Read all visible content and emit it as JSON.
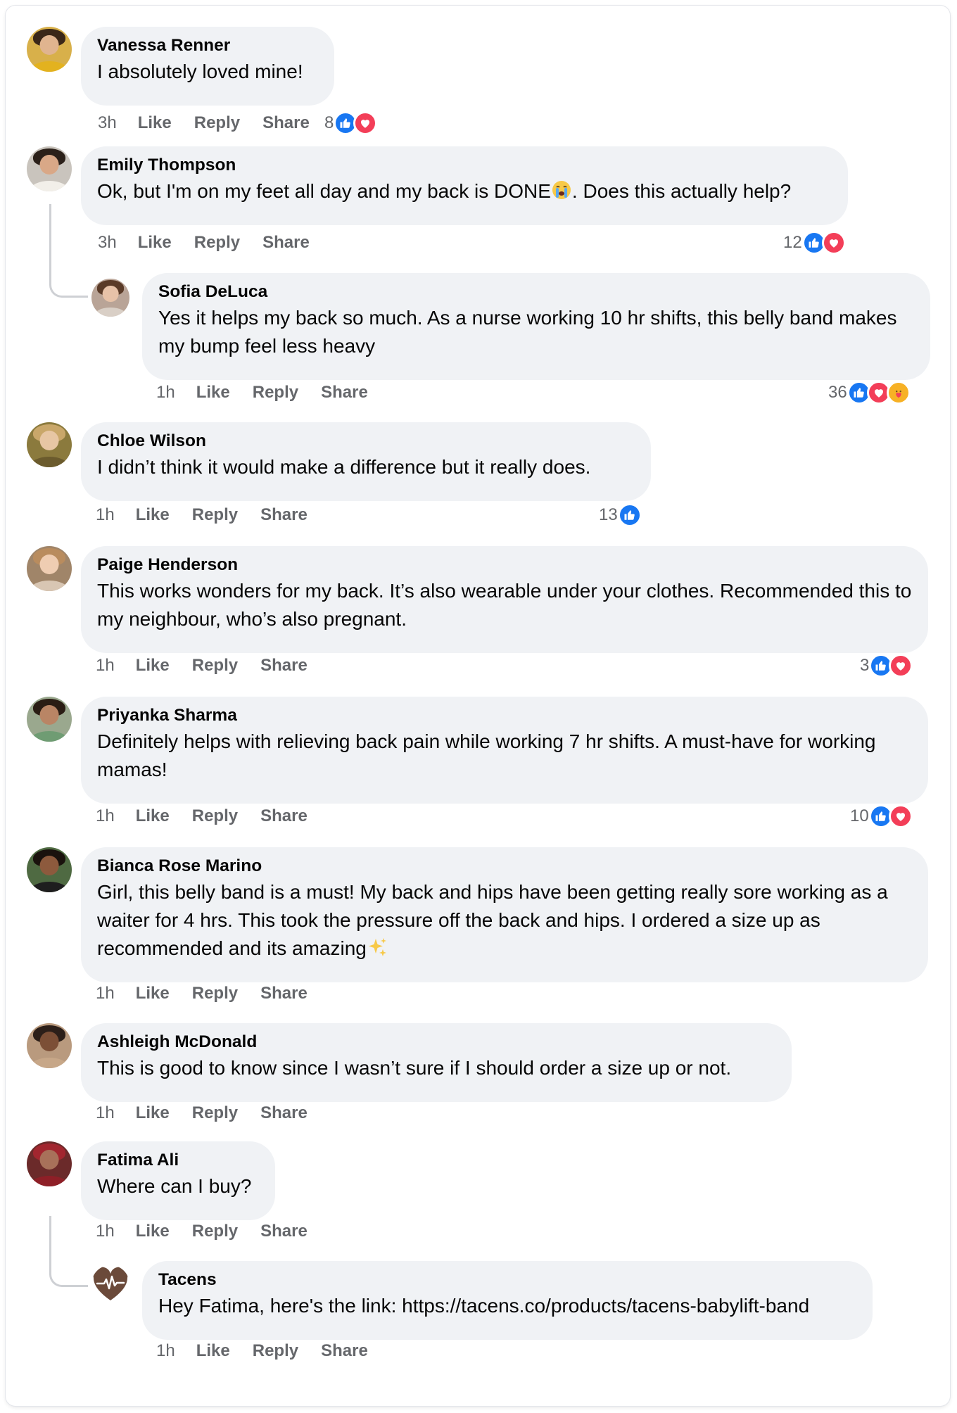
{
  "comments": [
    {
      "name": "Vanessa Renner",
      "text": "I absolutely loved mine!",
      "time": "3h",
      "like": "Like",
      "reply": "Reply",
      "share": "Share",
      "reaction_count": "8",
      "reactions": [
        "like",
        "love"
      ],
      "avatar_colors": {
        "bg": "#d8b04a",
        "hair": "#3a2718",
        "face": "#e0b48f",
        "body": "#e3b21f"
      }
    },
    {
      "name": "Emily Thompson",
      "text_before": "Ok, but I'm on my feet all day and my back is DONE",
      "emoji": "crying-face-emoji",
      "text_after": ". Does this actually help?",
      "time": "3h",
      "like": "Like",
      "reply": "Reply",
      "share": "Share",
      "reaction_count": "12",
      "reactions": [
        "like",
        "love"
      ],
      "avatar_colors": {
        "bg": "#c9c4bd",
        "hair": "#2b2019",
        "face": "#d9a887",
        "body": "#f2efe9"
      }
    },
    {
      "name": "Sofia DeLuca",
      "text": "Yes it helps my back so much. As a nurse working 10 hr shifts, this belly band makes my bump feel less heavy",
      "time": "1h",
      "like": "Like",
      "reply": "Reply",
      "share": "Share",
      "reaction_count": "36",
      "reactions": [
        "like",
        "love",
        "care"
      ],
      "avatar_colors": {
        "bg": "#b9a497",
        "hair": "#5a3b28",
        "face": "#e7c2a8",
        "body": "#d9cfc6"
      }
    },
    {
      "name": "Chloe Wilson",
      "text": "I didn’t think it would make a difference but it really does.",
      "time": "1h",
      "like": "Like",
      "reply": "Reply",
      "share": "Share",
      "reaction_count": "13",
      "reactions": [
        "like"
      ],
      "avatar_colors": {
        "bg": "#8b7a3d",
        "hair": "#c9a76a",
        "face": "#e7c6a4",
        "body": "#6b5b2d"
      }
    },
    {
      "name": "Paige Henderson",
      "text": "This works wonders for my back. It’s also wearable under your clothes. Recommended this to my neighbour, who’s also pregnant.",
      "time": "1h",
      "like": "Like",
      "reply": "Reply",
      "share": "Share",
      "reaction_count": "3",
      "reactions": [
        "like",
        "love"
      ],
      "avatar_colors": {
        "bg": "#a08569",
        "hair": "#b98c5e",
        "face": "#efcdb2",
        "body": "#d8c6b3"
      }
    },
    {
      "name": "Priyanka Sharma",
      "text": "Definitely helps with relieving back pain while working 7 hr shifts. A must-have for working mamas!",
      "time": "1h",
      "like": "Like",
      "reply": "Reply",
      "share": "Share",
      "reaction_count": "10",
      "reactions": [
        "like",
        "love"
      ],
      "avatar_colors": {
        "bg": "#9aa88e",
        "hair": "#2a1d14",
        "face": "#b98565",
        "body": "#6f9c73"
      }
    },
    {
      "name": "Bianca Rose Marino",
      "text_before": "Girl, this belly band is a must! My back and hips have been getting really sore working as a waiter for 4 hrs. This took the pressure off the back and hips. I ordered a size up as recommended and its amazing",
      "emoji": "sparkles-emoji",
      "text_after": "",
      "time": "1h",
      "like": "Like",
      "reply": "Reply",
      "share": "Share",
      "avatar_colors": {
        "bg": "#4f6a42",
        "hair": "#1a120d",
        "face": "#8d5a3d",
        "body": "#1e1e1e"
      }
    },
    {
      "name": "Ashleigh McDonald",
      "text": "This is good to know since I wasn’t sure if I should order a size up or not.",
      "time": "1h",
      "like": "Like",
      "reply": "Reply",
      "share": "Share",
      "avatar_colors": {
        "bg": "#b99a7e",
        "hair": "#2c1f19",
        "face": "#7c4f36",
        "body": "#c7a788"
      }
    },
    {
      "name": "Fatima Ali",
      "text": "Where can I buy?",
      "time": "1h",
      "like": "Like",
      "reply": "Reply",
      "share": "Share",
      "avatar_colors": {
        "bg": "#6b2a2a",
        "hair": "#a2262f",
        "face": "#a8715a",
        "body": "#8e1f27"
      }
    },
    {
      "name": "Tacens",
      "text": "Hey Fatima, here's the link: https://tacens.co/products/tacens-babylift-band",
      "time": "1h",
      "like": "Like",
      "reply": "Reply",
      "share": "Share",
      "logo_color": "#6b4a3a"
    }
  ],
  "colors": {
    "like": "#1877f2",
    "love": "#f33e58",
    "care": "#f7b125",
    "bubble": "#f0f2f5",
    "meta": "#65676b"
  }
}
